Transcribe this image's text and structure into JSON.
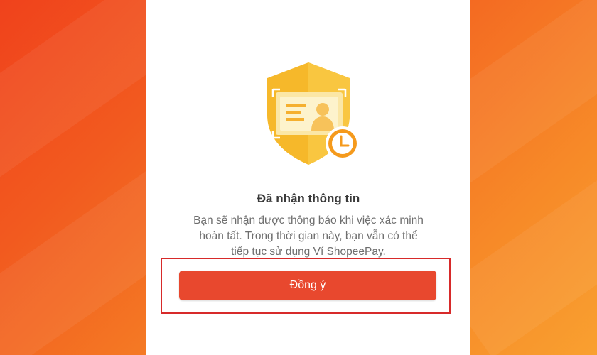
{
  "dialog": {
    "title": "Đã nhận thông tin",
    "message_lines": [
      "Bạn sẽ nhận được thông báo khi việc xác minh",
      "hoàn tất. Trong thời gian này, bạn vẫn có thể",
      "tiếp tục sử dụng Ví ShopeePay."
    ],
    "confirm_label": "Đồng ý",
    "illustration_icon": "id-verification-shield-clock-icon"
  },
  "colors": {
    "background_left": "#f0421c",
    "background_right": "#f9a030",
    "button": "#e8482e",
    "highlight_border": "#d72a2a",
    "shield": "#f6b82a",
    "clock": "#f59a1c"
  }
}
